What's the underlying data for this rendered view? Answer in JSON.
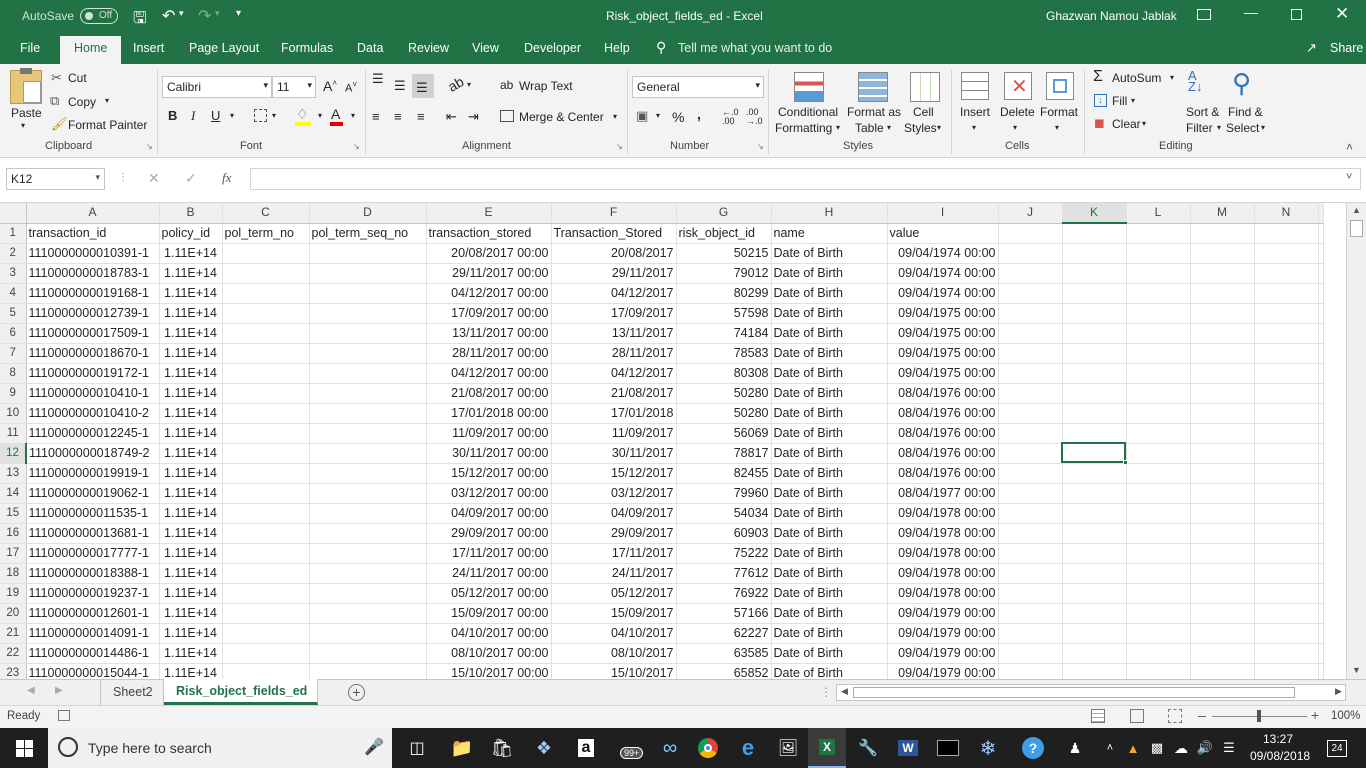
{
  "titlebar": {
    "autosave_label": "AutoSave",
    "autosave_state": "Off",
    "doc_title": "Risk_object_fields_ed  -  Excel",
    "user_name": "Ghazwan Namou Jablak"
  },
  "tabs": [
    "File",
    "Home",
    "Insert",
    "Page Layout",
    "Formulas",
    "Data",
    "Review",
    "View",
    "Developer",
    "Help"
  ],
  "tell_me": "Tell me what you want to do",
  "share": "Share",
  "ribbon": {
    "clipboard": {
      "paste": "Paste",
      "cut": "Cut",
      "copy": "Copy",
      "format_painter": "Format Painter",
      "group": "Clipboard"
    },
    "font": {
      "name": "Calibri",
      "size": "11",
      "group": "Font"
    },
    "alignment": {
      "wrap": "Wrap Text",
      "merge": "Merge & Center",
      "group": "Alignment"
    },
    "number": {
      "format": "General",
      "percent": "%",
      "comma": ",",
      "group": "Number"
    },
    "styles": {
      "conditional_1": "Conditional",
      "conditional_2": "Formatting",
      "format_table_1": "Format as",
      "format_table_2": "Table",
      "cell_styles_1": "Cell",
      "cell_styles_2": "Styles",
      "group": "Styles"
    },
    "cells": {
      "insert": "Insert",
      "delete": "Delete",
      "format": "Format",
      "group": "Cells"
    },
    "editing": {
      "autosum": "AutoSum",
      "fill": "Fill",
      "clear": "Clear",
      "sort_1": "Sort &",
      "sort_2": "Filter",
      "find_1": "Find &",
      "find_2": "Select",
      "group": "Editing"
    }
  },
  "formula_bar": {
    "name_box": "K12",
    "fx": "fx",
    "value": ""
  },
  "columns": [
    "A",
    "B",
    "C",
    "D",
    "E",
    "F",
    "G",
    "H",
    "I",
    "J",
    "K",
    "L",
    "M",
    "N"
  ],
  "header_row": [
    "transaction_id",
    "policy_id",
    "pol_term_no",
    "pol_term_seq_no",
    "transaction_stored",
    "Transaction_Stored",
    "risk_object_id",
    "name",
    "value"
  ],
  "rows": [
    [
      "1110000000010391-1",
      "1.11E+14",
      "",
      "",
      "20/08/2017 00:00",
      "20/08/2017",
      "50215",
      "Date of Birth",
      "09/04/1974 00:00"
    ],
    [
      "1110000000018783-1",
      "1.11E+14",
      "",
      "",
      "29/11/2017 00:00",
      "29/11/2017",
      "79012",
      "Date of Birth",
      "09/04/1974 00:00"
    ],
    [
      "1110000000019168-1",
      "1.11E+14",
      "",
      "",
      "04/12/2017 00:00",
      "04/12/2017",
      "80299",
      "Date of Birth",
      "09/04/1974 00:00"
    ],
    [
      "1110000000012739-1",
      "1.11E+14",
      "",
      "",
      "17/09/2017 00:00",
      "17/09/2017",
      "57598",
      "Date of Birth",
      "09/04/1975 00:00"
    ],
    [
      "1110000000017509-1",
      "1.11E+14",
      "",
      "",
      "13/11/2017 00:00",
      "13/11/2017",
      "74184",
      "Date of Birth",
      "09/04/1975 00:00"
    ],
    [
      "1110000000018670-1",
      "1.11E+14",
      "",
      "",
      "28/11/2017 00:00",
      "28/11/2017",
      "78583",
      "Date of Birth",
      "09/04/1975 00:00"
    ],
    [
      "1110000000019172-1",
      "1.11E+14",
      "",
      "",
      "04/12/2017 00:00",
      "04/12/2017",
      "80308",
      "Date of Birth",
      "09/04/1975 00:00"
    ],
    [
      "1110000000010410-1",
      "1.11E+14",
      "",
      "",
      "21/08/2017 00:00",
      "21/08/2017",
      "50280",
      "Date of Birth",
      "08/04/1976 00:00"
    ],
    [
      "1110000000010410-2",
      "1.11E+14",
      "",
      "",
      "17/01/2018 00:00",
      "17/01/2018",
      "50280",
      "Date of Birth",
      "08/04/1976 00:00"
    ],
    [
      "1110000000012245-1",
      "1.11E+14",
      "",
      "",
      "11/09/2017 00:00",
      "11/09/2017",
      "56069",
      "Date of Birth",
      "08/04/1976 00:00"
    ],
    [
      "1110000000018749-2",
      "1.11E+14",
      "",
      "",
      "30/11/2017 00:00",
      "30/11/2017",
      "78817",
      "Date of Birth",
      "08/04/1976 00:00"
    ],
    [
      "1110000000019919-1",
      "1.11E+14",
      "",
      "",
      "15/12/2017 00:00",
      "15/12/2017",
      "82455",
      "Date of Birth",
      "08/04/1976 00:00"
    ],
    [
      "1110000000019062-1",
      "1.11E+14",
      "",
      "",
      "03/12/2017 00:00",
      "03/12/2017",
      "79960",
      "Date of Birth",
      "08/04/1977 00:00"
    ],
    [
      "1110000000011535-1",
      "1.11E+14",
      "",
      "",
      "04/09/2017 00:00",
      "04/09/2017",
      "54034",
      "Date of Birth",
      "09/04/1978 00:00"
    ],
    [
      "1110000000013681-1",
      "1.11E+14",
      "",
      "",
      "29/09/2017 00:00",
      "29/09/2017",
      "60903",
      "Date of Birth",
      "09/04/1978 00:00"
    ],
    [
      "1110000000017777-1",
      "1.11E+14",
      "",
      "",
      "17/11/2017 00:00",
      "17/11/2017",
      "75222",
      "Date of Birth",
      "09/04/1978 00:00"
    ],
    [
      "1110000000018388-1",
      "1.11E+14",
      "",
      "",
      "24/11/2017 00:00",
      "24/11/2017",
      "77612",
      "Date of Birth",
      "09/04/1978 00:00"
    ],
    [
      "1110000000019237-1",
      "1.11E+14",
      "",
      "",
      "05/12/2017 00:00",
      "05/12/2017",
      "76922",
      "Date of Birth",
      "09/04/1978 00:00"
    ],
    [
      "1110000000012601-1",
      "1.11E+14",
      "",
      "",
      "15/09/2017 00:00",
      "15/09/2017",
      "57166",
      "Date of Birth",
      "09/04/1979 00:00"
    ],
    [
      "1110000000014091-1",
      "1.11E+14",
      "",
      "",
      "04/10/2017 00:00",
      "04/10/2017",
      "62227",
      "Date of Birth",
      "09/04/1979 00:00"
    ],
    [
      "1110000000014486-1",
      "1.11E+14",
      "",
      "",
      "08/10/2017 00:00",
      "08/10/2017",
      "63585",
      "Date of Birth",
      "09/04/1979 00:00"
    ],
    [
      "1110000000015044-1",
      "1.11E+14",
      "",
      "",
      "15/10/2017 00:00",
      "15/10/2017",
      "65852",
      "Date of Birth",
      "09/04/1979 00:00"
    ]
  ],
  "selected_cell": {
    "col": "K",
    "row": 12
  },
  "sheets": [
    "Sheet2",
    "Risk_object_fields_ed"
  ],
  "active_sheet": "Risk_object_fields_ed",
  "status": {
    "ready": "Ready",
    "zoom": "100%"
  },
  "taskbar": {
    "search_placeholder": "Type here to search",
    "time": "13:27",
    "date": "09/08/2018",
    "badge": "99+",
    "notif": "24"
  },
  "colors": {
    "excel_green": "#217346",
    "taskbar": "#1f1f1f"
  }
}
